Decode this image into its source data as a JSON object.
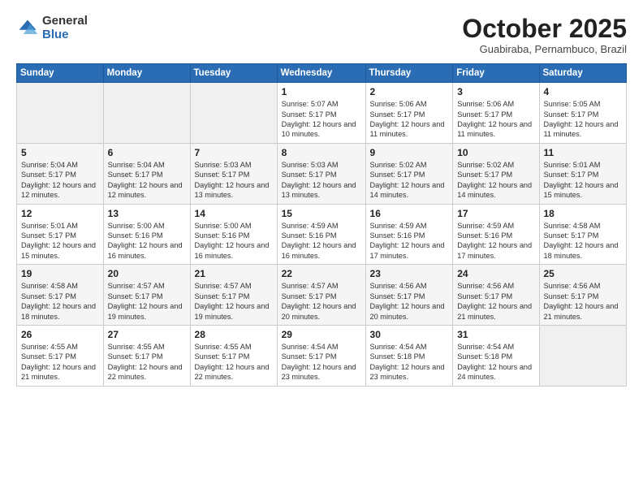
{
  "logo": {
    "general": "General",
    "blue": "Blue"
  },
  "header": {
    "month": "October 2025",
    "location": "Guabiraba, Pernambuco, Brazil"
  },
  "weekdays": [
    "Sunday",
    "Monday",
    "Tuesday",
    "Wednesday",
    "Thursday",
    "Friday",
    "Saturday"
  ],
  "weeks": [
    [
      {
        "day": "",
        "info": ""
      },
      {
        "day": "",
        "info": ""
      },
      {
        "day": "",
        "info": ""
      },
      {
        "day": "1",
        "info": "Sunrise: 5:07 AM\nSunset: 5:17 PM\nDaylight: 12 hours and 10 minutes."
      },
      {
        "day": "2",
        "info": "Sunrise: 5:06 AM\nSunset: 5:17 PM\nDaylight: 12 hours and 11 minutes."
      },
      {
        "day": "3",
        "info": "Sunrise: 5:06 AM\nSunset: 5:17 PM\nDaylight: 12 hours and 11 minutes."
      },
      {
        "day": "4",
        "info": "Sunrise: 5:05 AM\nSunset: 5:17 PM\nDaylight: 12 hours and 11 minutes."
      }
    ],
    [
      {
        "day": "5",
        "info": "Sunrise: 5:04 AM\nSunset: 5:17 PM\nDaylight: 12 hours and 12 minutes."
      },
      {
        "day": "6",
        "info": "Sunrise: 5:04 AM\nSunset: 5:17 PM\nDaylight: 12 hours and 12 minutes."
      },
      {
        "day": "7",
        "info": "Sunrise: 5:03 AM\nSunset: 5:17 PM\nDaylight: 12 hours and 13 minutes."
      },
      {
        "day": "8",
        "info": "Sunrise: 5:03 AM\nSunset: 5:17 PM\nDaylight: 12 hours and 13 minutes."
      },
      {
        "day": "9",
        "info": "Sunrise: 5:02 AM\nSunset: 5:17 PM\nDaylight: 12 hours and 14 minutes."
      },
      {
        "day": "10",
        "info": "Sunrise: 5:02 AM\nSunset: 5:17 PM\nDaylight: 12 hours and 14 minutes."
      },
      {
        "day": "11",
        "info": "Sunrise: 5:01 AM\nSunset: 5:17 PM\nDaylight: 12 hours and 15 minutes."
      }
    ],
    [
      {
        "day": "12",
        "info": "Sunrise: 5:01 AM\nSunset: 5:17 PM\nDaylight: 12 hours and 15 minutes."
      },
      {
        "day": "13",
        "info": "Sunrise: 5:00 AM\nSunset: 5:16 PM\nDaylight: 12 hours and 16 minutes."
      },
      {
        "day": "14",
        "info": "Sunrise: 5:00 AM\nSunset: 5:16 PM\nDaylight: 12 hours and 16 minutes."
      },
      {
        "day": "15",
        "info": "Sunrise: 4:59 AM\nSunset: 5:16 PM\nDaylight: 12 hours and 16 minutes."
      },
      {
        "day": "16",
        "info": "Sunrise: 4:59 AM\nSunset: 5:16 PM\nDaylight: 12 hours and 17 minutes."
      },
      {
        "day": "17",
        "info": "Sunrise: 4:59 AM\nSunset: 5:16 PM\nDaylight: 12 hours and 17 minutes."
      },
      {
        "day": "18",
        "info": "Sunrise: 4:58 AM\nSunset: 5:17 PM\nDaylight: 12 hours and 18 minutes."
      }
    ],
    [
      {
        "day": "19",
        "info": "Sunrise: 4:58 AM\nSunset: 5:17 PM\nDaylight: 12 hours and 18 minutes."
      },
      {
        "day": "20",
        "info": "Sunrise: 4:57 AM\nSunset: 5:17 PM\nDaylight: 12 hours and 19 minutes."
      },
      {
        "day": "21",
        "info": "Sunrise: 4:57 AM\nSunset: 5:17 PM\nDaylight: 12 hours and 19 minutes."
      },
      {
        "day": "22",
        "info": "Sunrise: 4:57 AM\nSunset: 5:17 PM\nDaylight: 12 hours and 20 minutes."
      },
      {
        "day": "23",
        "info": "Sunrise: 4:56 AM\nSunset: 5:17 PM\nDaylight: 12 hours and 20 minutes."
      },
      {
        "day": "24",
        "info": "Sunrise: 4:56 AM\nSunset: 5:17 PM\nDaylight: 12 hours and 21 minutes."
      },
      {
        "day": "25",
        "info": "Sunrise: 4:56 AM\nSunset: 5:17 PM\nDaylight: 12 hours and 21 minutes."
      }
    ],
    [
      {
        "day": "26",
        "info": "Sunrise: 4:55 AM\nSunset: 5:17 PM\nDaylight: 12 hours and 21 minutes."
      },
      {
        "day": "27",
        "info": "Sunrise: 4:55 AM\nSunset: 5:17 PM\nDaylight: 12 hours and 22 minutes."
      },
      {
        "day": "28",
        "info": "Sunrise: 4:55 AM\nSunset: 5:17 PM\nDaylight: 12 hours and 22 minutes."
      },
      {
        "day": "29",
        "info": "Sunrise: 4:54 AM\nSunset: 5:17 PM\nDaylight: 12 hours and 23 minutes."
      },
      {
        "day": "30",
        "info": "Sunrise: 4:54 AM\nSunset: 5:18 PM\nDaylight: 12 hours and 23 minutes."
      },
      {
        "day": "31",
        "info": "Sunrise: 4:54 AM\nSunset: 5:18 PM\nDaylight: 12 hours and 24 minutes."
      },
      {
        "day": "",
        "info": ""
      }
    ]
  ]
}
